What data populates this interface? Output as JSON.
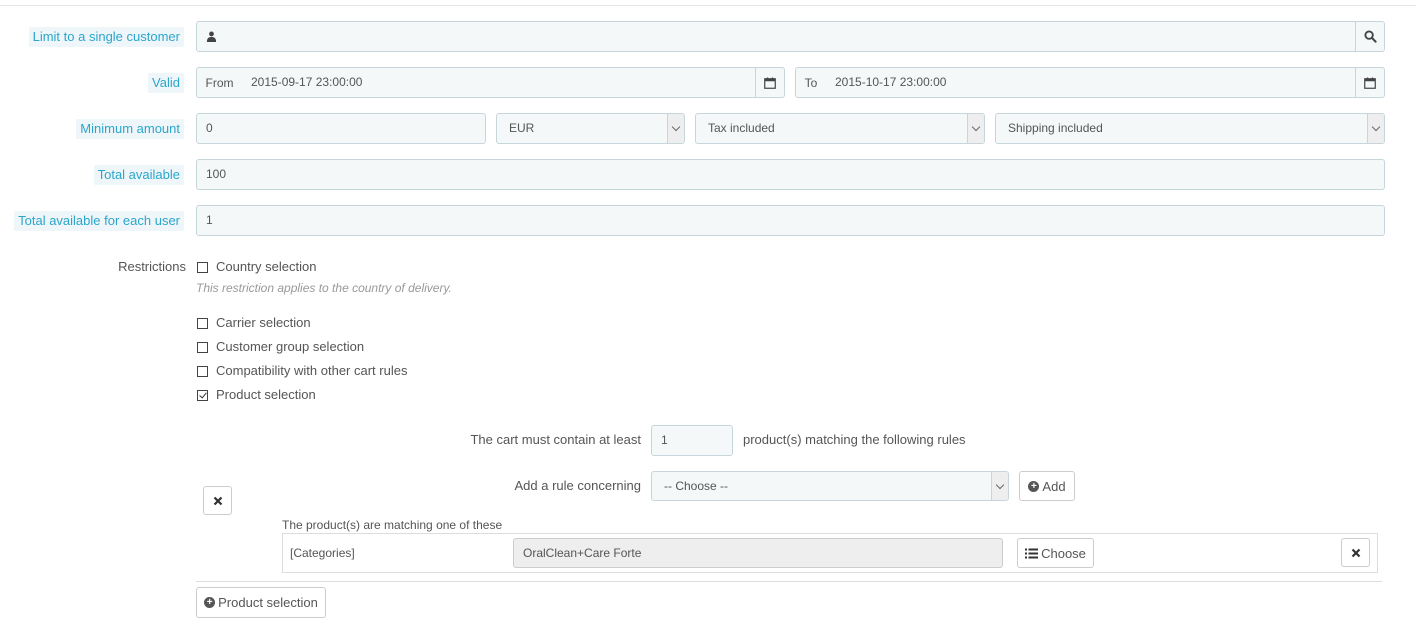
{
  "fields": {
    "customer": {
      "label": "Limit to a single customer",
      "value": ""
    },
    "valid": {
      "label": "Valid",
      "from_label": "From",
      "from_value": "2015-09-17 23:00:00",
      "to_label": "To",
      "to_value": "2015-10-17 23:00:00"
    },
    "minimum_amount": {
      "label": "Minimum amount",
      "value": "0",
      "currency": "EUR",
      "tax": "Tax included",
      "shipping": "Shipping included"
    },
    "total_available": {
      "label": "Total available",
      "value": "100"
    },
    "total_per_user": {
      "label": "Total available for each user",
      "value": "1"
    }
  },
  "restrictions": {
    "label": "Restrictions",
    "country": {
      "label": "Country selection",
      "checked": false,
      "help": "This restriction applies to the country of delivery."
    },
    "carrier": {
      "label": "Carrier selection",
      "checked": false
    },
    "customer_group": {
      "label": "Customer group selection",
      "checked": false
    },
    "compatibility": {
      "label": "Compatibility with other cart rules",
      "checked": false
    },
    "product": {
      "label": "Product selection",
      "checked": true
    }
  },
  "product_rules": {
    "min_text": "The cart must contain at least",
    "min_value": "1",
    "suffix_text": "product(s) matching the following rules",
    "add_rule_label": "Add a rule concerning",
    "choose_placeholder": "-- Choose --",
    "add_button": "Add",
    "matching_title": "The product(s) are matching one of these",
    "rule": {
      "type": "[Categories]",
      "value": "OralClean+Care Forte",
      "choose_button": "Choose"
    },
    "product_selection_button": "Product selection"
  },
  "colors": {
    "label_accent": "#2ba6cb",
    "label_bg": "#eef6fa",
    "input_bg": "#f5f8f9",
    "input_border": "#c7d6db"
  },
  "icons": {
    "user": "user-icon",
    "search": "search-icon",
    "calendar": "calendar-icon",
    "remove": "remove-icon",
    "plus": "plus-circle-icon",
    "list": "list-icon"
  }
}
